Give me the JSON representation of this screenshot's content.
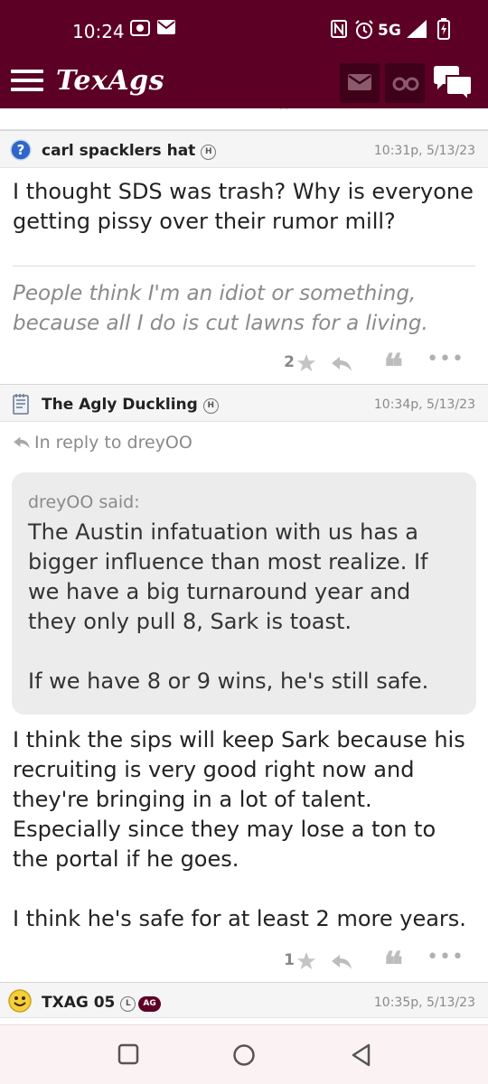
{
  "status": {
    "time": "10:24",
    "network": "5G"
  },
  "header": {
    "logo": "TexAgs"
  },
  "posts": [
    {
      "username": "carl spacklers hat",
      "badges": [
        "H"
      ],
      "time": "10:31p, 5/13/23",
      "body": "I thought SDS was trash? Why is everyone getting pissy over their rumor mill?",
      "signature": "People think I'm an idiot or something, because all I do is cut lawns for a living.",
      "stars": "2",
      "more": "•••"
    },
    {
      "username": "The Agly Duckling",
      "badges": [
        "H"
      ],
      "time": "10:34p, 5/13/23",
      "reply_to": "In reply to dreyOO",
      "quote_author": "dreyOO said:",
      "quote_text": "The Austin infatuation with us has a bigger influence than most realize. If we have a big turnaround year and they only pull 8, Sark is toast.\n\nIf we have 8 or 9 wins, he's still safe.",
      "body": "I think the sips will keep Sark because his recruiting is very good right now and they're bringing in a lot of talent. Especially since they may lose a ton to the portal if he goes.\n\nI think he's safe for at least 2 more years.",
      "stars": "1",
      "more": "•••"
    },
    {
      "username": "TXAG 05",
      "badges": [
        "L",
        "AG"
      ],
      "time": "10:35p, 5/13/23"
    }
  ],
  "colors": {
    "brand": "#5c0025",
    "brand_dark": "#3f0019"
  }
}
